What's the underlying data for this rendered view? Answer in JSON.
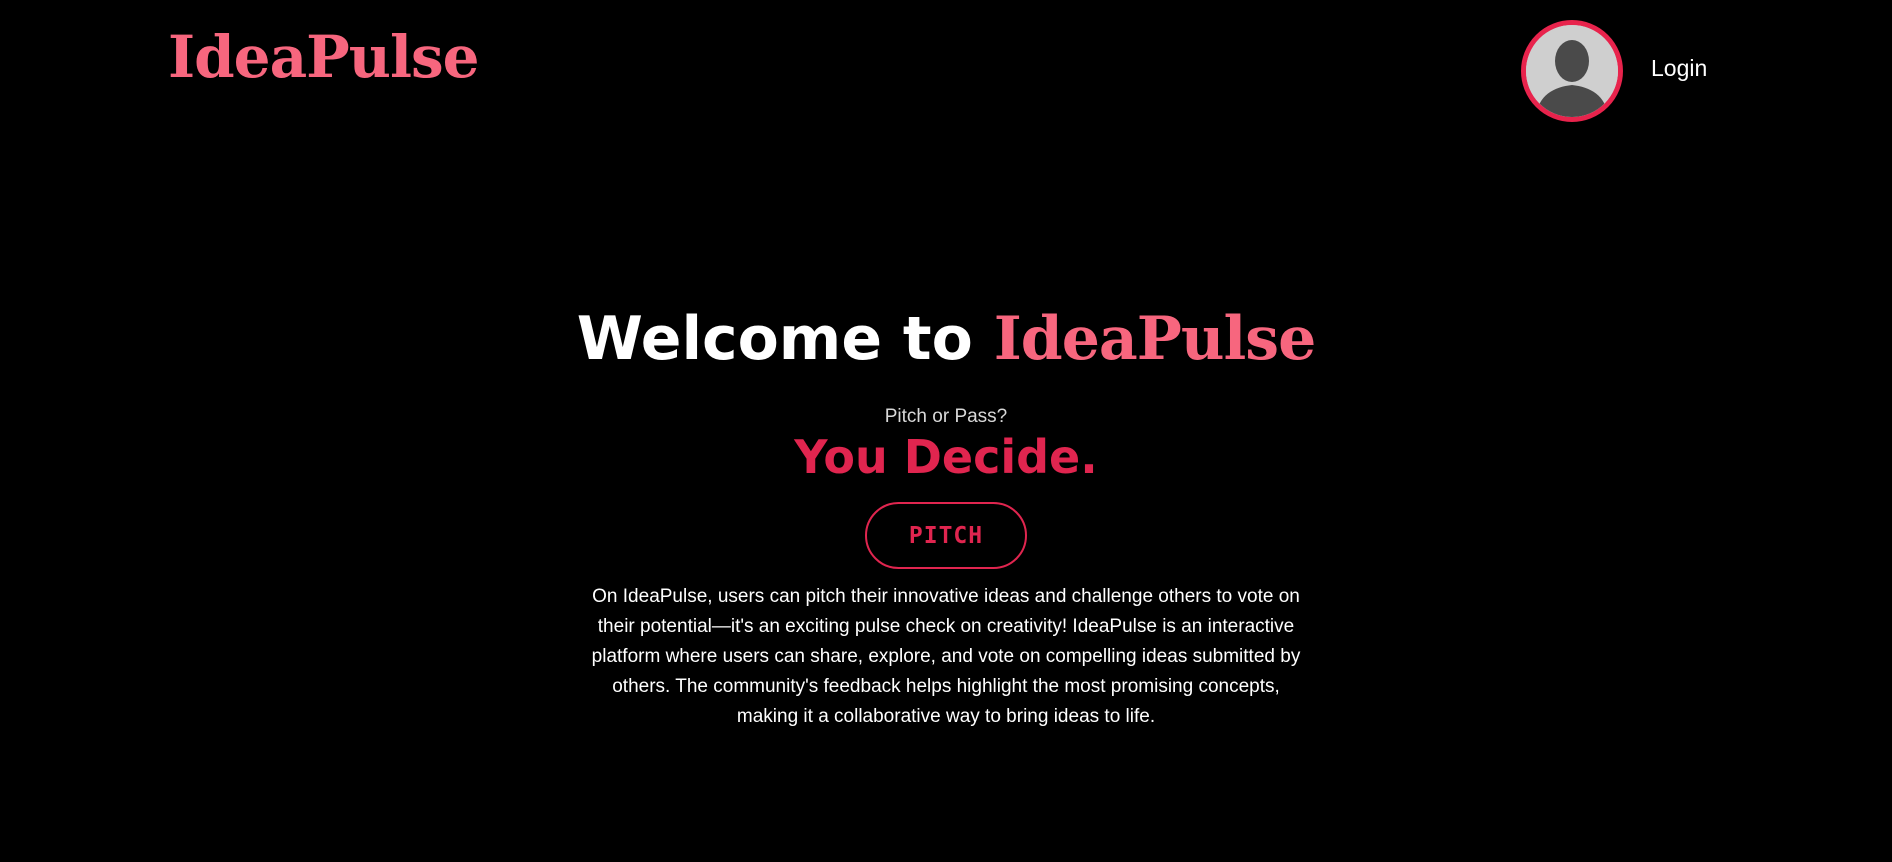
{
  "header": {
    "logo_text": "IdeaPulse",
    "avatar_icon": "user-silhouette-icon",
    "login_label": "Login"
  },
  "hero": {
    "welcome_text": "Welcome to ",
    "brand_text": "IdeaPulse",
    "tagline": "Pitch or Pass?",
    "decide_text": "You Decide.",
    "pitch_button_label": "PITCH",
    "description": "On IdeaPulse, users can pitch their innovative ideas and challenge others to vote on their potential—it's an exciting pulse check on creativity! IdeaPulse is an interactive platform where users can share, explore, and vote on compelling ideas submitted by others. The community's feedback helps highlight the most promising concepts, making it a collaborative way to bring ideas to life."
  },
  "colors": {
    "background": "#000000",
    "brand_pink": "#f7667e",
    "accent_red": "#e0254f",
    "text": "#ffffff"
  }
}
